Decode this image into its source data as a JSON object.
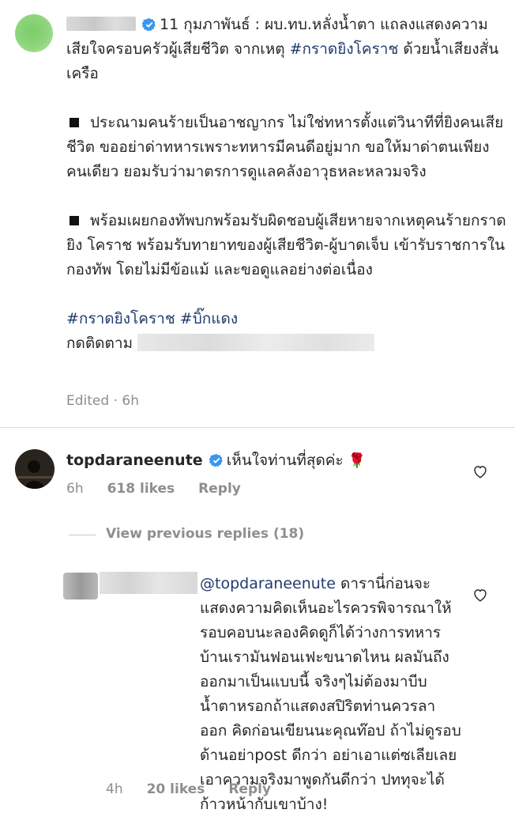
{
  "post": {
    "caption_intro": "11 กุมภาพันธ์ : ผบ.ทบ.หลั่งน้ำตา แถลงแสดงความเสียใจครอบครัวผู้เสียชีวิต จากเหตุ ",
    "caption_hashtag": "#กราดยิงโคราช",
    "caption_tail": " ด้วยน้ำเสียงสั่นเครือ",
    "bullet1": "ประณามคนร้ายเป็นอาชญากร ไม่ใช่ทหารตั้งแต่วินาทีที่ยิงคนเสียชีวิต ขออย่าด่าทหารเพราะทหารมีคนดีอยู่มาก ขอให้มาด่าตนเพียงคนเดียว ยอมรับว่ามาตรการดูแลคลังอาวุธหละหลวมจริง",
    "bullet2": "พร้อมเผยกองทัพบกพร้อมรับผิดชอบผู้เสียหายจากเหตุคนร้ายกราดยิง โคราช พร้อมรับทายาทของผู้เสียชีวิต-ผู้บาดเจ็บ เข้ารับราชการในกองทัพ โดยไม่มีข้อแม้ และขอดูแลอย่างต่อเนื่อง",
    "tags": "#กราดยิงโคราช #บิ๊กแดง",
    "follow_label": "กดติดตาม",
    "edited": "Edited · 6h"
  },
  "comment1": {
    "username": "topdaraneenute",
    "text": "เห็นใจท่านที่สุดค่ะ",
    "emoji": "🌹",
    "time": "6h",
    "likes": "618 likes",
    "reply": "Reply"
  },
  "view_previous": "View previous replies (18)",
  "comment2": {
    "mention": "@topdaraneenute",
    "text": " ดารานี่ก่อนจะแสดงความคิดเห็นอะไรควรพิจารณาให้รอบคอบนะลองคิดดูก็ได้ว่างการทหารบ้านเรามันฟอนเฟะขนาดไหน ผลมันถึงออกมาเป็นแบบนี้ จริงๆไม่ต้องมาบีบน้ำตาหรอกถ้าแสดงสปิริตท่านควรลาออก คิดก่อนเขียนนะคุณท๊อป ถ้าไม่ดูรอบด้านอย่าpost ดีกว่า อย่าเอาแต่ซเลียเลย เอาความจริงมาพูดกันดีกว่า ปททุจะได้ก้าวหน้ากับเขาบ้าง!",
    "time": "4h",
    "likes": "20 likes",
    "reply": "Reply"
  },
  "colors": {
    "link": "#1f3b6e",
    "meta": "#8e8e8e",
    "verified": "#3897f0"
  }
}
